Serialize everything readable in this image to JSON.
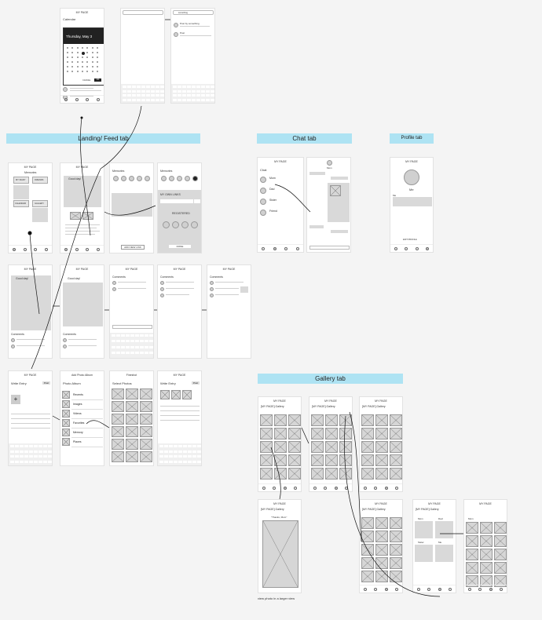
{
  "sections": {
    "landing": "Landing/ Feed tab",
    "chat": "Chat tab",
    "profile": "Profile tab",
    "gallery": "Gallery tab"
  },
  "calendar": {
    "header": "MY PAGE",
    "title": "Calendar",
    "date_label": "Thursday, May 3",
    "cancel": "CANCEL",
    "ok": "OK"
  },
  "search": {
    "query": "something",
    "result1": "Post by something",
    "result2": "Post"
  },
  "feed": {
    "header": "MY PAGE",
    "title": "Memories",
    "diary_label": "MY DIARY",
    "feed_label": "FRIENDS",
    "calendar_label": "CALENDAR",
    "gallery_label": "GALLERY",
    "good_day": "Good day!",
    "comments": "Comments",
    "add_new": "ADD NEW LINK",
    "my_own_links": "MY OWN LINKS",
    "registered": "REGISTERED",
    "done": "DONE"
  },
  "write": {
    "header": "MY PAGE",
    "title": "Write Entry",
    "post": "Post",
    "add_photo_album": "Add Photo Album",
    "photo_album": "Photo Album",
    "select_photos": "Select Photos",
    "albums": [
      "Recents",
      "Images",
      "Videos",
      "Favorites",
      "Memory",
      "Places"
    ],
    "fineshot": "Fineshot"
  },
  "chat": {
    "header": "MY PAGE",
    "title": "Chat",
    "contacts": [
      "Mom",
      "Dad",
      "Sister",
      "Friend"
    ],
    "other": "Mom"
  },
  "profile": {
    "header": "MY PAGE",
    "name": "Me",
    "me_label": "Me",
    "edit": "EDIT PROFILE"
  },
  "gallery": {
    "header": "MY PAGE",
    "title": "[MY PAGE] Gallery",
    "photo_title": "\"Thanks, Mom\"",
    "caption": "view photo in a larger view",
    "folders": [
      "Mom",
      "Dad",
      "Sister",
      "Me"
    ]
  },
  "colors": {
    "banner": "#aee3f3",
    "dark": "#222222"
  }
}
